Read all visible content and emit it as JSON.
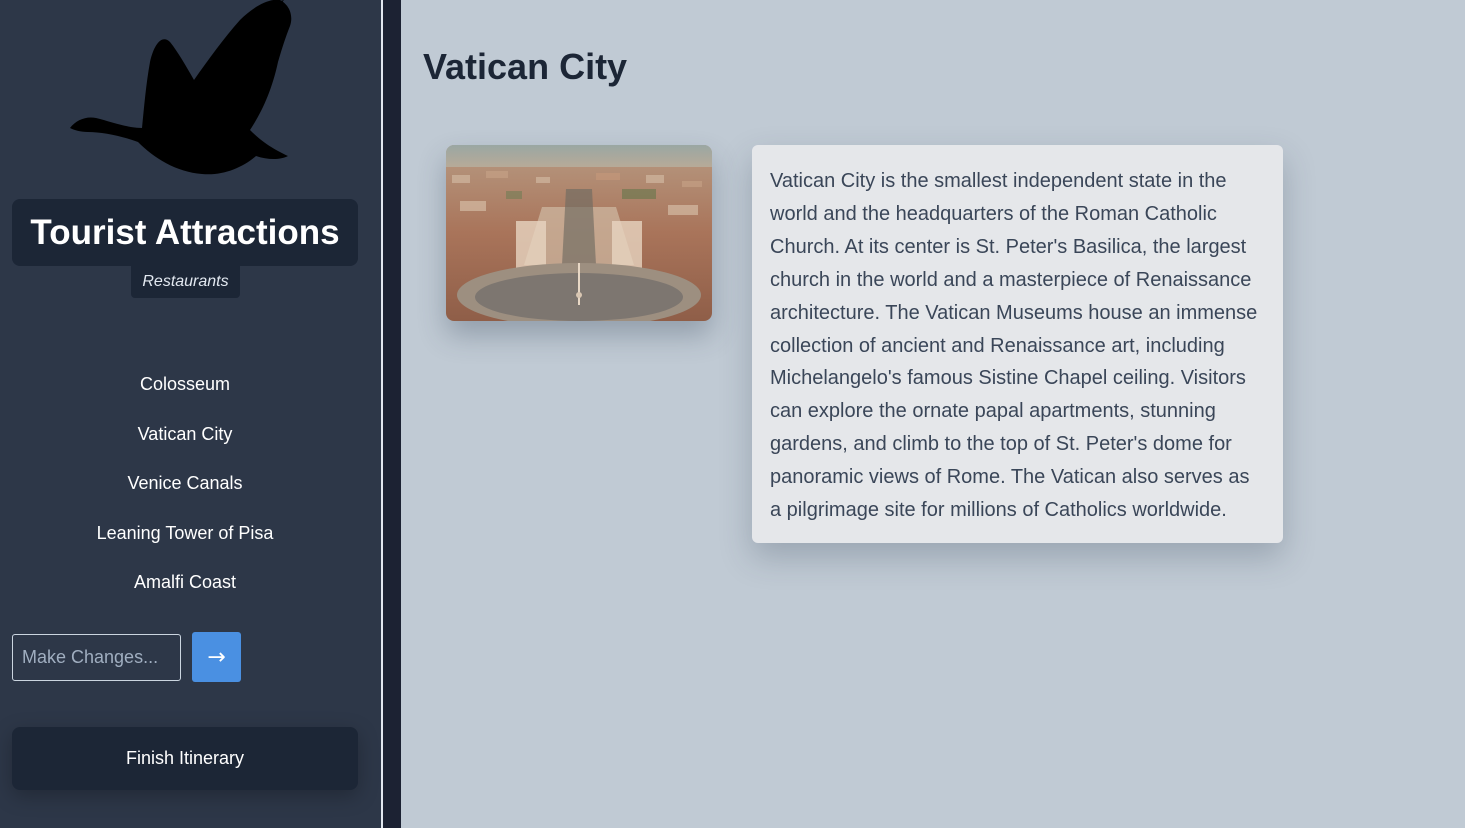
{
  "sidebar": {
    "title": "Tourist Attractions",
    "restaurants_label": "Restaurants",
    "nav_items": [
      {
        "label": "Colosseum"
      },
      {
        "label": "Vatican City"
      },
      {
        "label": "Venice Canals"
      },
      {
        "label": "Leaning Tower of Pisa"
      },
      {
        "label": "Amalfi Coast"
      }
    ],
    "changes_placeholder": "Make Changes...",
    "submit_label": "→",
    "finish_label": "Finish Itinerary",
    "logo_icon": "goose-silhouette-icon"
  },
  "main": {
    "title": "Vatican City",
    "description": "Vatican City is the smallest independent state in the world and the headquarters of the Roman Catholic Church. At its center is St. Peter's Basilica, the largest church in the world and a masterpiece of Renaissance architecture. The Vatican Museums house an immense collection of ancient and Renaissance art, including Michelangelo's famous Sistine Chapel ceiling. Visitors can explore the ornate papal apartments, stunning gardens, and climb to the top of St. Peter's dome for panoramic views of Rome. The Vatican also serves as a pilgrimage site for millions of Catholics worldwide."
  },
  "colors": {
    "sidebar_bg": "#2d3748",
    "panel_dark": "#1c2636",
    "main_bg": "#c0cad4",
    "accent_blue": "#4a90e2",
    "card_bg": "#e5e7ea"
  }
}
